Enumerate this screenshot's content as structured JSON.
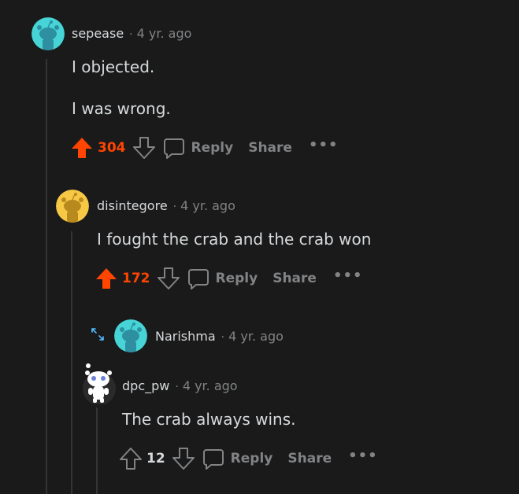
{
  "colors": {
    "background": "#1a1a1b",
    "upvote_active": "#ff4500",
    "muted": "#818384",
    "text": "#d7dadc",
    "avatar_cyan": "#46d4d6",
    "avatar_yellow": "#f7c846"
  },
  "comments": [
    {
      "username": "sepease",
      "separator": "·",
      "timestamp": "4 yr. ago",
      "body": [
        "I objected.",
        "I was wrong."
      ],
      "score": "304",
      "voted": "up",
      "reply_label": "Reply",
      "share_label": "Share",
      "more_label": "•••",
      "avatar_icon": "snoo-avatar-cyan"
    },
    {
      "username": "disintegore",
      "separator": "·",
      "timestamp": "4 yr. ago",
      "body": [
        "I fought the crab and the crab won"
      ],
      "score": "172",
      "voted": "up",
      "reply_label": "Reply",
      "share_label": "Share",
      "more_label": "•••",
      "avatar_icon": "snoo-avatar-yellow"
    },
    {
      "username": "Narishma",
      "separator": "·",
      "timestamp": "4 yr. ago",
      "collapsed": true,
      "avatar_icon": "snoo-avatar-cyan",
      "expand_icon": "expand-arrows-icon"
    },
    {
      "username": "dpc_pw",
      "separator": "·",
      "timestamp": "4 yr. ago",
      "body": [
        "The crab always wins."
      ],
      "score": "12",
      "voted": "none",
      "reply_label": "Reply",
      "share_label": "Share",
      "more_label": "•••",
      "avatar_icon": "snoo-avatar-white"
    }
  ]
}
